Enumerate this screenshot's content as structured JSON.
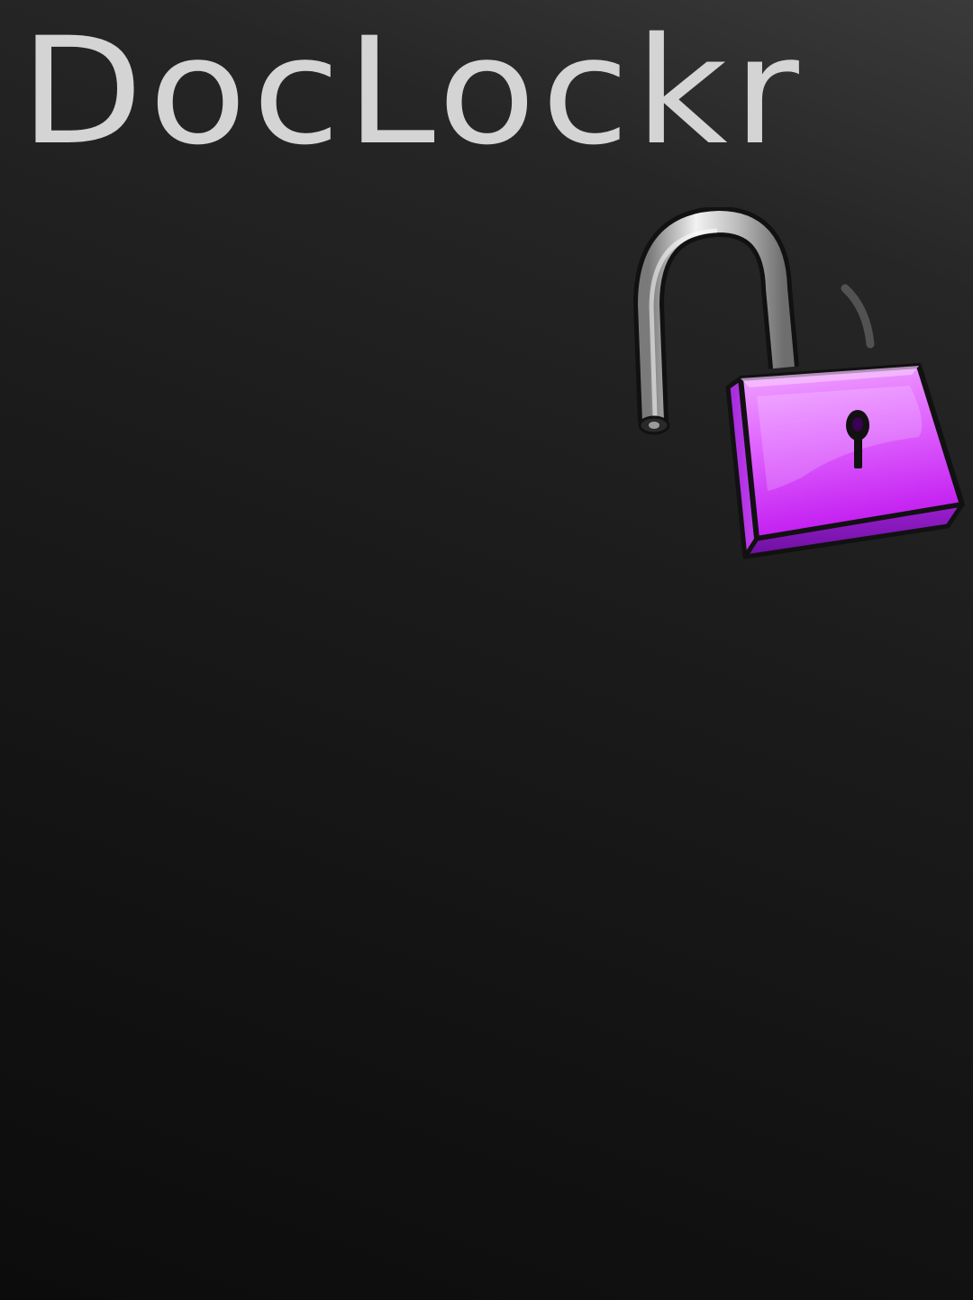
{
  "app": {
    "title": "DocLockr"
  },
  "icons": {
    "hero": "open-padlock-icon"
  },
  "colors": {
    "title": "#d4d4d4",
    "lock_body": "#cc33ff",
    "lock_shackle": "#c8c8c8",
    "background": "#1a1a1a"
  }
}
